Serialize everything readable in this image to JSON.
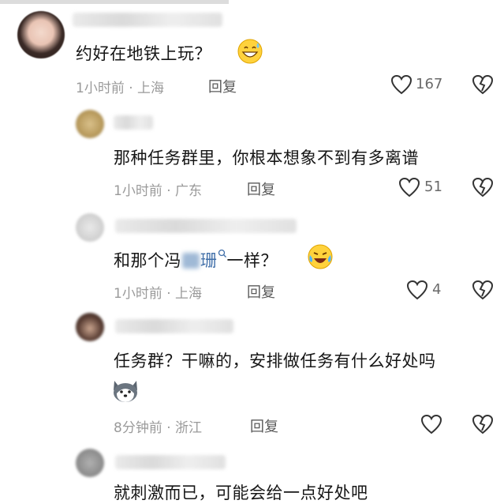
{
  "comments": [
    {
      "text": "约好在地铁上玩？",
      "time_loc": "1小时前 · 上海",
      "reply_label": "回复",
      "likes": "167",
      "emoji": "grinning-sweat-emoji"
    },
    {
      "text": "那种任务群里，你根本想象不到有多离谱",
      "time_loc": "1小时前 · 广东",
      "reply_label": "回复",
      "likes": "51"
    },
    {
      "text_before": "和那个冯",
      "text_link": "珊",
      "text_after": "一样？",
      "time_loc": "1小时前 · 上海",
      "reply_label": "回复",
      "likes": "4",
      "emoji": "crying-laughing-emoji"
    },
    {
      "text": "任务群？干嘛的，安排做任务有什么好处吗",
      "time_loc": "8分钟前 · 浙江",
      "reply_label": "回复",
      "likes": "",
      "emoji": "husky-dog-emoji"
    },
    {
      "text": "就刺激而已，可能会给一点好处吧"
    }
  ],
  "colors": {
    "link": "#3f6ea8",
    "heart": "#333333"
  },
  "icons": {
    "like": "heart-outline-icon",
    "dislike": "broken-heart-icon",
    "search": "search-icon"
  }
}
